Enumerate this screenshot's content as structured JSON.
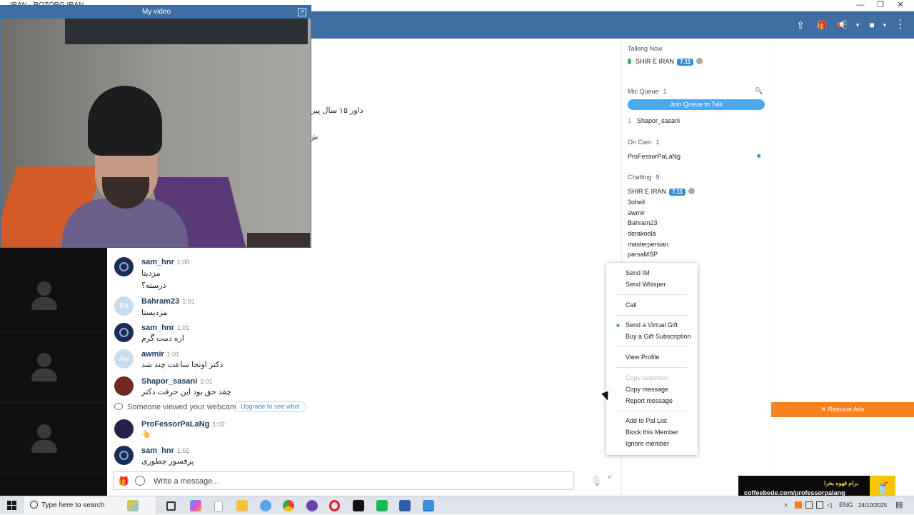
{
  "window": {
    "title": "IRAN - ROZORG IRAN",
    "minimize": "—",
    "restore": "❐",
    "close": "✕"
  },
  "header": {
    "icons": [
      "share-icon",
      "gift-icon",
      "megaphone-icon",
      "video-camera-icon",
      "more-icon"
    ],
    "share": "⇪",
    "gift": "🎁",
    "megaphone": "📢",
    "camera": "■",
    "more": "⋮"
  },
  "video": {
    "title": "My video",
    "expand": "↗"
  },
  "chat": {
    "fragments": [
      "داور ۱۵ سال پیر",
      "ش"
    ],
    "messages": [
      {
        "user": "sam_hnr",
        "time": "1:00",
        "lines": [
          "مزدیتا",
          "درسته؟"
        ],
        "avatar": ""
      },
      {
        "user": "Bahram23",
        "time": "1:01",
        "lines": [
          "مزدیستا"
        ],
        "avatar": "Ba"
      },
      {
        "user": "sam_hnr",
        "time": "1:01",
        "lines": [
          "اره دمت گرم"
        ],
        "avatar": ""
      },
      {
        "user": "awmir",
        "time": "1:01",
        "lines": [
          "دکتر اونجا ساعت چند شد"
        ],
        "avatar": "Aw"
      },
      {
        "user": "Shapor_sasani",
        "time": "1:01",
        "lines": [
          "چقد حق بود این حرفت دکتر"
        ],
        "avatar": ""
      },
      {
        "user": "ProFessorPaLaNg",
        "time": "1:02",
        "lines": [
          "👆"
        ],
        "avatar": ""
      },
      {
        "user": "sam_hnr",
        "time": "1:02",
        "lines": [
          "پرفسور چطوری"
        ],
        "avatar": ""
      }
    ],
    "notice": {
      "text": "Someone viewed your webcam",
      "upgrade": "Upgrade to see who!"
    },
    "composer": {
      "placeholder": "Write a message...",
      "gift": "🎁",
      "mic": "🎙",
      "caret": "˄"
    }
  },
  "panel": {
    "talking_now": {
      "label": "Talking Now",
      "user": "SHIR E IRAN",
      "badge": "7.11"
    },
    "mic_queue": {
      "label": "Mic Queue",
      "count": "1",
      "join": "Join Queue to Talk",
      "queue_num": "1",
      "queue_user": "Shapor_sasani",
      "search": "🔍"
    },
    "on_cam": {
      "label": "On Cam",
      "count": "1",
      "user": "ProFessorPaLaNg",
      "cam": "■"
    },
    "chatting": {
      "label": "Chatting",
      "count": "9",
      "users": [
        {
          "name": "SHIR E IRAN",
          "badge": "7.11"
        },
        {
          "name": "3oheil"
        },
        {
          "name": "awmir"
        },
        {
          "name": "Bahram23"
        },
        {
          "name": "derakoola"
        },
        {
          "name": "masterpersian"
        },
        {
          "name": "parsaMSP"
        }
      ]
    }
  },
  "context_menu": {
    "send_im": "Send IM",
    "send_whisper": "Send Whisper",
    "call": "Call",
    "send_gift": "Send a Virtual Gift",
    "buy_gift": "Buy a Gift Subscription",
    "view_profile": "View Profile",
    "copy_selection": "Copy selection",
    "copy_message": "Copy message",
    "report_message": "Report message",
    "add_pal": "Add to Pal List",
    "block": "Block this Member",
    "ignore": "Ignore member"
  },
  "ads": {
    "remove": "✕ Remove Ads",
    "coffee_line1": "برام قهوه بخرا",
    "coffee_line2": "coffeebede.com/professorpalang",
    "cup": "🥤"
  },
  "taskbar": {
    "search_placeholder": "Type here to search",
    "lang": "ENG",
    "date": "24/10/2025",
    "tray_up": "˄",
    "notif": "▤"
  },
  "colors": {
    "header": "#3e6ea3",
    "accent": "#4da7e8",
    "remove_ads": "#f58220",
    "coffee_yellow": "#f7c400"
  }
}
